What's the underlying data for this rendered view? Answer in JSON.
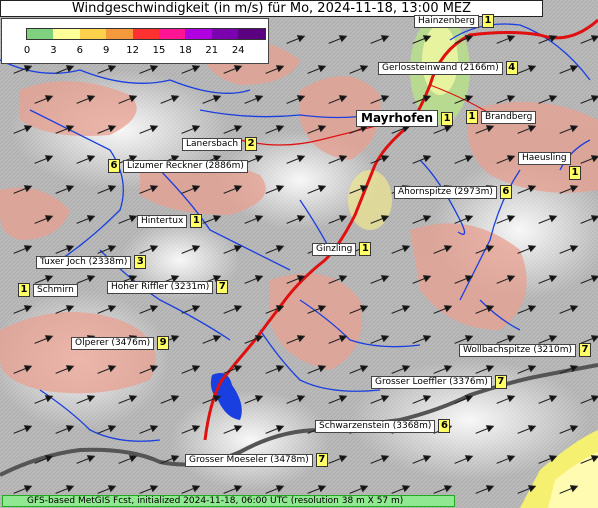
{
  "title": "Windgeschwindigkeit (in m/s) für Mo, 2024-11-18, 13:00 MEZ",
  "legend": {
    "ticks": [
      "0",
      "3",
      "6",
      "9",
      "12",
      "15",
      "18",
      "21",
      "24"
    ],
    "colors": [
      "#7fd07f",
      "#ffff99",
      "#ffd24d",
      "#f59a3c",
      "#ff3030",
      "#ff1493",
      "#b000e0",
      "#7a00b0",
      "#5a0080"
    ]
  },
  "peaks": [
    {
      "name": "Hainzenberg",
      "value": "1"
    },
    {
      "name": "Gerlossteinwand (2166m)",
      "value": "4"
    },
    {
      "name": "Mayrhofen",
      "value": "1"
    },
    {
      "name": "Brandberg",
      "value": "1"
    },
    {
      "name": "Lanersbach",
      "value": "2"
    },
    {
      "name": "Lizumer Reckner (2886m)",
      "value": "6"
    },
    {
      "name": "Haeusling",
      "value": "1"
    },
    {
      "name": "Ahornspitze (2973m)",
      "value": "6"
    },
    {
      "name": "Hintertux",
      "value": "1"
    },
    {
      "name": "Ginzling",
      "value": "1"
    },
    {
      "name": "Tuxer Joch (2338m)",
      "value": "3"
    },
    {
      "name": "Schmirn",
      "value": "1"
    },
    {
      "name": "Hoher Riffler (3231m)",
      "value": "7"
    },
    {
      "name": "Olperer (3476m)",
      "value": "9"
    },
    {
      "name": "Wollbachspitze (3210m)",
      "value": "7"
    },
    {
      "name": "Grosser Loeffler (3376m)",
      "value": "7"
    },
    {
      "name": "Schwarzenstein (3368m)",
      "value": "6"
    },
    {
      "name": "Grosser Moeseler (3478m)",
      "value": "7"
    }
  ],
  "footer": "GFS-based MetGIS Fcst, initialized 2024-11-18, 06:00 UTC  (resolution 38 m X 57 m)"
}
